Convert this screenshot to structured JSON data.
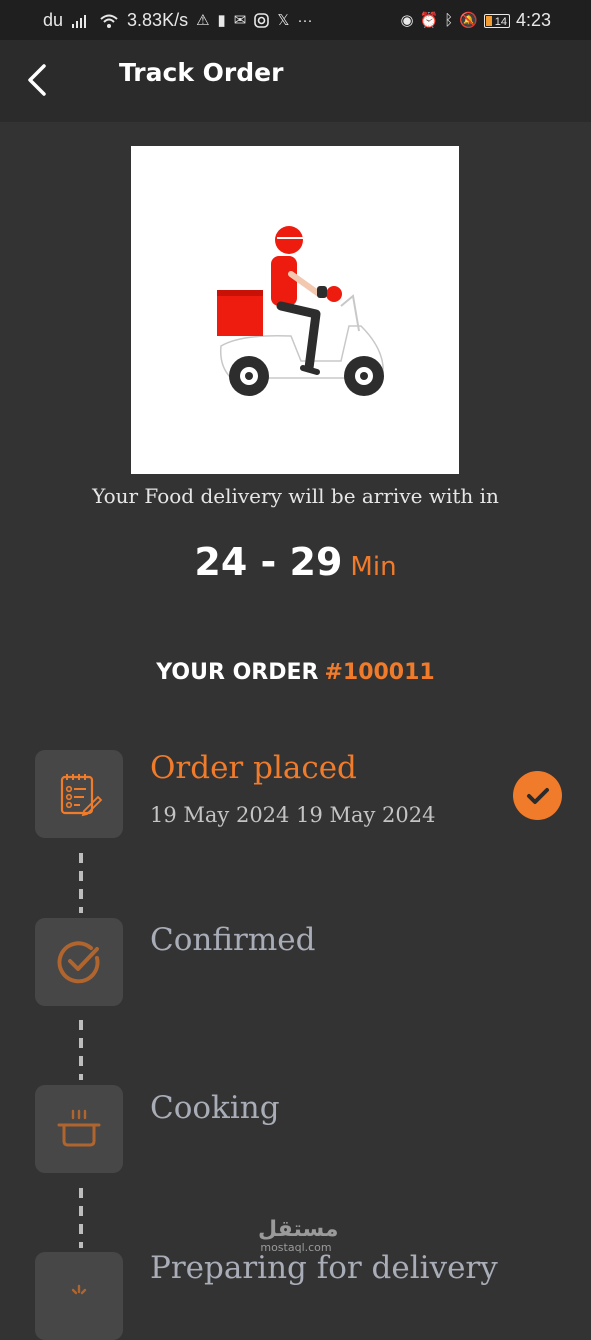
{
  "status_bar": {
    "carrier": "du",
    "speed": "3.83K/s",
    "battery": "14",
    "time": "4:23",
    "icons_left": [
      "signal-icon",
      "wifi-icon",
      "warning-icon",
      "battery-alert-icon",
      "mail-icon",
      "instagram-icon",
      "x-icon",
      "more-icon"
    ],
    "icons_right": [
      "eye-icon",
      "alarm-icon",
      "bluetooth-icon",
      "mute-icon"
    ]
  },
  "header": {
    "title": "Track Order",
    "back_icon": "chevron-left-icon"
  },
  "delivery": {
    "message": "Your Food delivery will be arrive with in",
    "eta_range": "24 - 29",
    "eta_unit": "Min"
  },
  "order": {
    "label": "YOUR ORDER",
    "number": "#100011"
  },
  "steps": [
    {
      "title": "Order placed",
      "date": "19 May 2024 19 May 2024",
      "icon": "clipboard-checklist-icon",
      "completed": true
    },
    {
      "title": "Confirmed",
      "icon": "check-circle-icon",
      "completed": false
    },
    {
      "title": "Cooking",
      "icon": "cooking-pot-icon",
      "completed": false
    },
    {
      "title": "Preparing for delivery",
      "icon": "box-icon",
      "completed": false
    }
  ],
  "watermark": {
    "arabic": "مستقل",
    "latin": "mostaql.com"
  },
  "colors": {
    "accent": "#f07b2a",
    "background": "#333333",
    "appbar": "#2b2b2b",
    "icon_tile": "#474747",
    "pending_text": "#a9adb8"
  }
}
